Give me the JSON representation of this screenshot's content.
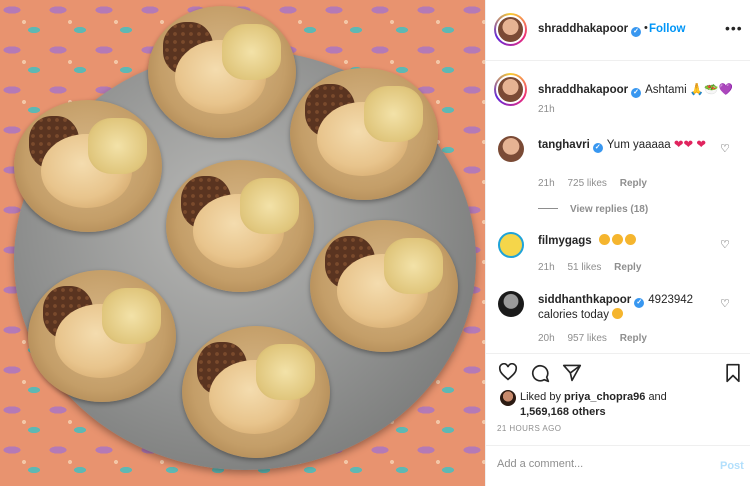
{
  "post": {
    "author": "shraddhakapoor",
    "follow_label": "Follow",
    "dot": "•",
    "more": "•••",
    "caption": "Ashtami 🙏🥗💜",
    "caption_time": "21h"
  },
  "comments": [
    {
      "user": "tanghavri",
      "verified": true,
      "text": "Yum yaaaaa",
      "time": "21h",
      "likes": "725 likes",
      "reply": "Reply",
      "view_replies": "View replies (18)"
    },
    {
      "user": "filmygags",
      "verified": false,
      "text": "",
      "time": "21h",
      "likes": "51 likes",
      "reply": "Reply"
    },
    {
      "user": "siddhanthkapoor",
      "verified": true,
      "text": "4923942 calories today",
      "time": "20h",
      "likes": "957 likes",
      "reply": "Reply"
    }
  ],
  "liked_by": {
    "prefix": "Liked by",
    "user": "priya_chopra96",
    "and": "and",
    "count": "1,569,168 others"
  },
  "timestamp": "21 HOURS AGO",
  "add_comment": {
    "placeholder": "Add a comment...",
    "post_label": "Post"
  },
  "colors": {
    "accent": "#0095f6",
    "verified": "#3897f0",
    "heart_red": "#e0245e",
    "muted": "#8e8e8e"
  },
  "icons": [
    "heart-icon",
    "comment-icon",
    "share-icon",
    "bookmark-icon",
    "more-icon",
    "verified-icon"
  ]
}
